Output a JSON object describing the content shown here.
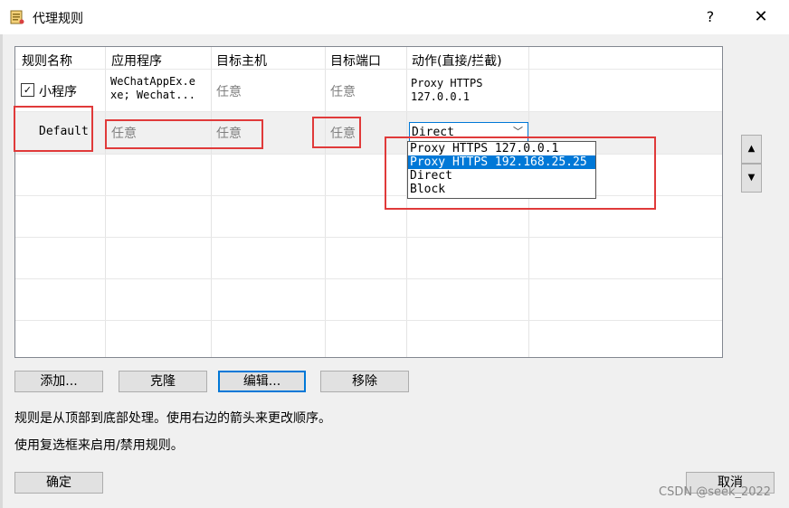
{
  "window": {
    "title": "代理规则",
    "help": "?",
    "close": "✕"
  },
  "table": {
    "headers": [
      "规则名称",
      "应用程序",
      "目标主机",
      "目标端口",
      "动作(直接/拦截)"
    ],
    "rows": [
      {
        "name": "小程序",
        "checked": true,
        "app_line1": "WeChatAppEx.e",
        "app_line2": "xe; Wechat...",
        "host": "任意",
        "port": "任意",
        "action_line1": "Proxy HTTPS",
        "action_line2": "127.0.0.1"
      },
      {
        "name": "Default",
        "app": "任意",
        "host": "任意",
        "port": "任意",
        "action": "Direct"
      }
    ]
  },
  "dropdown": {
    "options": [
      "Proxy HTTPS 127.0.0.1",
      "Proxy HTTPS 192.168.25.25",
      "Direct",
      "Block"
    ],
    "highlighted_index": 1
  },
  "move_buttons": {
    "up": "▲",
    "down": "▼"
  },
  "buttons": {
    "add": "添加...",
    "clone": "克隆",
    "edit": "编辑...",
    "remove": "移除",
    "ok": "确定",
    "cancel": "取消"
  },
  "info": {
    "line1": "规则是从顶部到底部处理。使用右边的箭头来更改顺序。",
    "line2": "使用复选框来启用/禁用规则。"
  },
  "watermark": "CSDN @seek_2022",
  "colors": {
    "highlight": "#e03a3a",
    "accent": "#0078d7"
  }
}
